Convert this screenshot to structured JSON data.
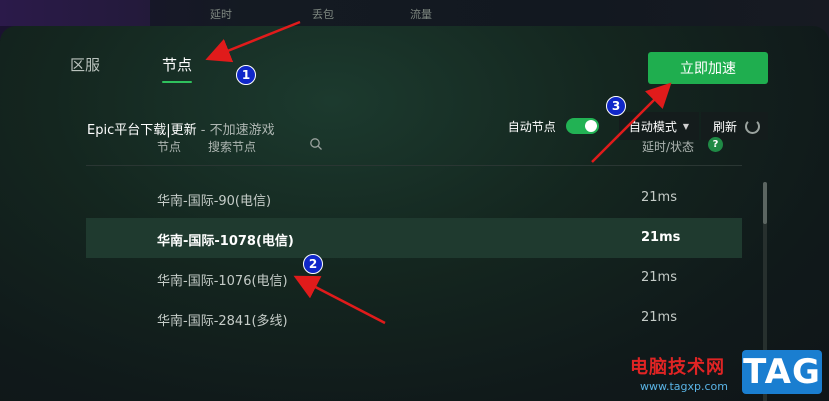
{
  "background": {
    "stats": [
      "延时",
      "丢包",
      "流量"
    ]
  },
  "tabs": [
    {
      "label": "区服",
      "active": false
    },
    {
      "label": "节点",
      "active": true
    }
  ],
  "accelerate_button": "立即加速",
  "game": {
    "title": "Epic平台下载|更新",
    "subtitle": " - 不加速游戏"
  },
  "controls": {
    "auto_node_label": "自动节点",
    "auto_node_on": true,
    "mode_label": "自动模式",
    "refresh_label": "刷新"
  },
  "table_header": {
    "node": "节点",
    "search_placeholder": "搜索节点",
    "latency": "延时/状态",
    "help": "?"
  },
  "nodes": [
    {
      "name": "华南-国际-90(电信)",
      "latency": "21ms",
      "selected": false
    },
    {
      "name": "华南-国际-1078(电信)",
      "latency": "21ms",
      "selected": true
    },
    {
      "name": "华南-国际-1076(电信)",
      "latency": "21ms",
      "selected": false
    },
    {
      "name": "华南-国际-2841(多线)",
      "latency": "21ms",
      "selected": false
    }
  ],
  "annotations": {
    "badge_1": "1",
    "badge_2": "2",
    "badge_3": "3",
    "arrow_color": "#e01b1b",
    "badge_color": "#1027c9"
  },
  "watermark": {
    "text": "电脑技术网",
    "url": "www.tagxp.com",
    "tag": "TAG"
  },
  "colors": {
    "accent_green": "#1fae4f",
    "selected_row": "#1f3a2f"
  }
}
